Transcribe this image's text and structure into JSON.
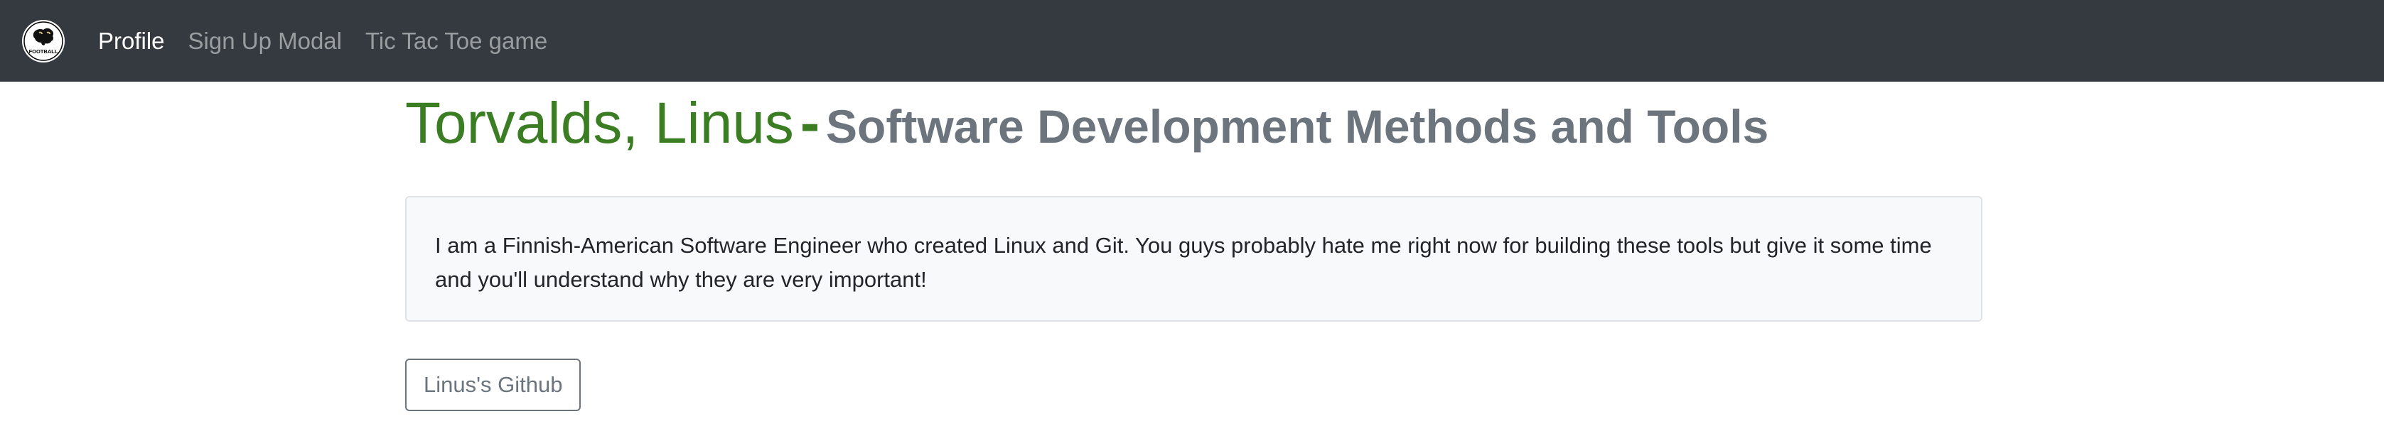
{
  "navbar": {
    "logo_text": "FOOTBALL",
    "links": [
      {
        "label": "Profile",
        "active": true
      },
      {
        "label": "Sign Up Modal",
        "active": false
      },
      {
        "label": "Tic Tac Toe game",
        "active": false
      }
    ]
  },
  "profile": {
    "name": "Torvalds, Linus",
    "separator": "-",
    "course": "Software Development Methods and Tools",
    "bio": "I am a Finnish-American Software Engineer who created Linux and Git. You guys probably hate me right now for building these tools but give it some time and you'll understand why they are very important!",
    "github_button": "Linus's Github"
  },
  "colors": {
    "navbar_bg": "#343a40",
    "name_green": "#3b7d23",
    "muted_gray": "#6c757d"
  },
  "icons": {
    "brand": "buffalo-football-logo-icon"
  }
}
